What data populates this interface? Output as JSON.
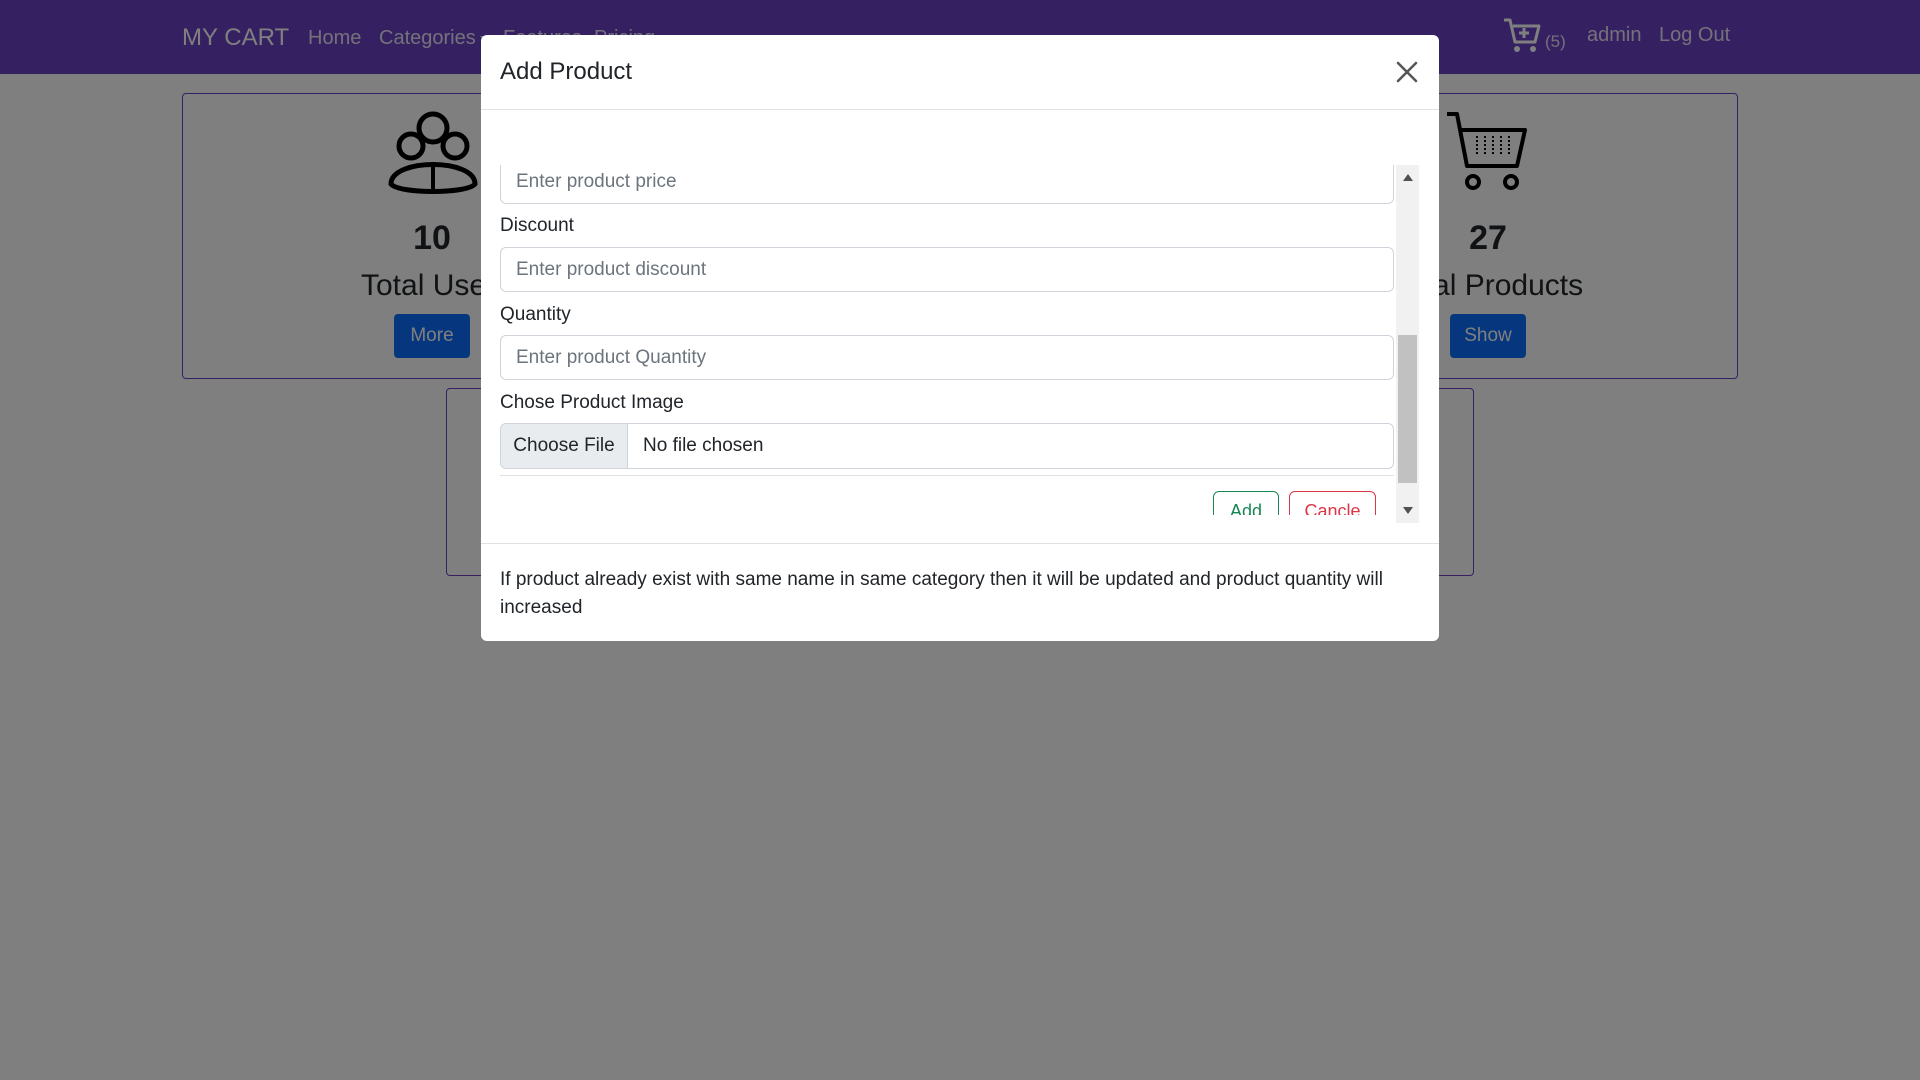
{
  "navbar": {
    "brand": "MY CART",
    "links": [
      "Home",
      "Categories",
      "Features",
      "Pricing"
    ],
    "cart_count": "(5)",
    "user": "admin",
    "logout": "Log Out",
    "color": "#6a40c4"
  },
  "dashboard": {
    "users": {
      "count": "10",
      "label": "Total Users",
      "button": "More"
    },
    "products": {
      "count": "27",
      "label": "Total Products",
      "button": "Show"
    }
  },
  "modal": {
    "title": "Add Product",
    "price_placeholder": "Enter product price",
    "discount_label": "Discount",
    "discount_placeholder": "Enter product discount",
    "quantity_label": "Quantity",
    "quantity_placeholder": "Enter product Quantity",
    "image_label": "Chose Product Image",
    "file_button": "Choose File",
    "file_status": "No file chosen",
    "add_button": "Add",
    "cancel_button": "Cancle",
    "footer_note": "If product already exist with same name in same category then it will be updated and product quantity will increased"
  },
  "icons": {
    "close": "close-icon",
    "cart": "cart-icon",
    "users": "users-icon",
    "products_cart": "shopping-cart-icon"
  }
}
